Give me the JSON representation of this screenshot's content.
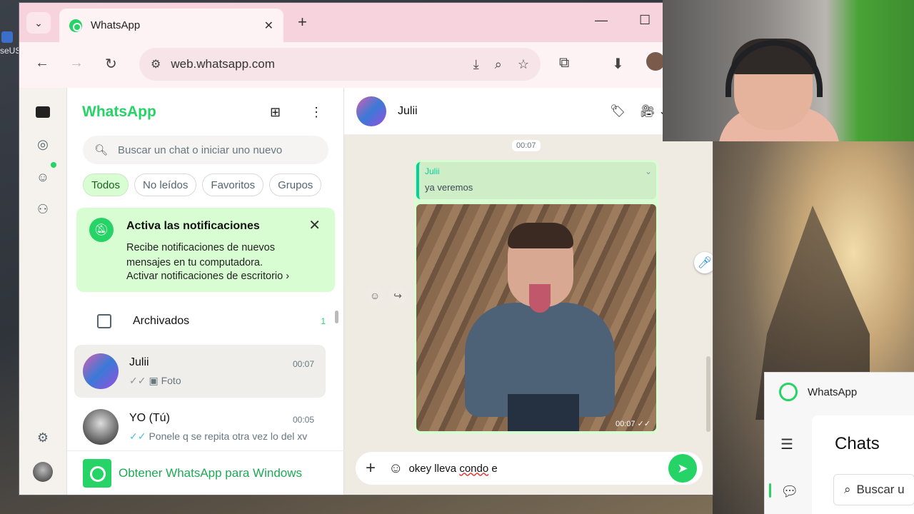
{
  "desktop": {
    "icon_label": "seUSTiti..."
  },
  "browser": {
    "tab_title": "WhatsApp",
    "url": "web.whatsapp.com"
  },
  "whatsapp": {
    "app_title": "WhatsApp",
    "search_placeholder": "Buscar un chat o iniciar uno nuevo",
    "filters": [
      "Todos",
      "No leídos",
      "Favoritos",
      "Grupos"
    ],
    "notification": {
      "title": "Activa las notificaciones",
      "body": "Recibe notificaciones de nuevos mensajes en tu computadora.",
      "link": "Activar notificaciones de escritorio ›"
    },
    "archived": {
      "label": "Archivados",
      "count": "1"
    },
    "chats": [
      {
        "name": "Julii",
        "time": "00:07",
        "preview": "Foto"
      },
      {
        "name": "YO (Tú)",
        "time": "00:05",
        "preview": "Ponele q se repita otra vez lo del xv"
      }
    ],
    "get_app": "Obtener WhatsApp para Windows",
    "brand_color": "#25d366"
  },
  "conversation": {
    "contact": "Julii",
    "date_chip": "00:07",
    "quoted": {
      "author": "Julii",
      "text": "ya veremos"
    },
    "photo_time": "00:07",
    "draft_plain": "okey lleva ",
    "draft_wavy": "condo",
    "draft_tail": " e"
  },
  "desktop_app": {
    "title": "WhatsApp",
    "heading": "Chats",
    "search_placeholder": "Buscar u"
  }
}
